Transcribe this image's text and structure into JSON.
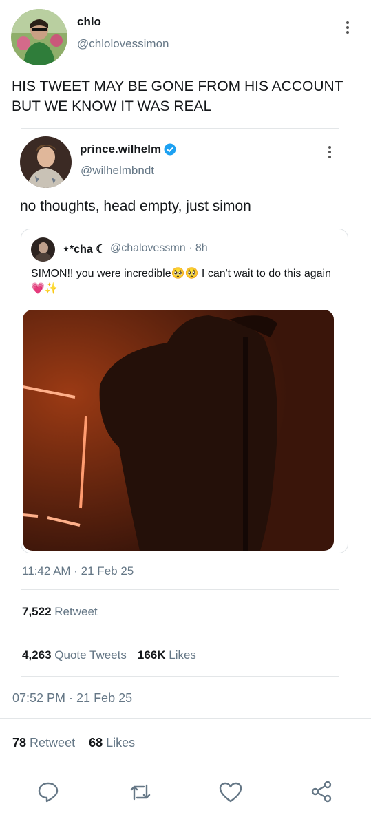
{
  "outer_tweet": {
    "display_name": "chlo",
    "handle": "@chlolovessimon",
    "text": "HIS TWEET MAY BE GONE FROM HIS ACCOUNT BUT WE KNOW IT WAS REAL",
    "timestamp": "07:52 PM · 21 Feb 25",
    "retweets_count": "78",
    "retweets_label": "Retweet",
    "likes_count": "68",
    "likes_label": "Likes"
  },
  "inner_tweet": {
    "display_name": "prince.wilhelm",
    "handle": "@wilhelmbndt",
    "text": "no thoughts, head empty, just simon",
    "timestamp": "11:42 AM · 21 Feb 25",
    "retweets_count": "7,522",
    "retweets_label": "Retweet",
    "quotes_count": "4,263",
    "quotes_label": "Quote Tweets",
    "likes_count": "166K",
    "likes_label": "Likes"
  },
  "quoted_tweet": {
    "display_name": "⋆*cha ☾",
    "handle_time": "@chalovessmn · 8h",
    "text": "SIMON!! you were incredible🥺🥺 I can't wait to do this again💗✨"
  },
  "actions": {
    "icons": [
      "reply-icon",
      "retweet-icon",
      "like-icon",
      "share-icon"
    ],
    "accent": "#1da1f2"
  }
}
